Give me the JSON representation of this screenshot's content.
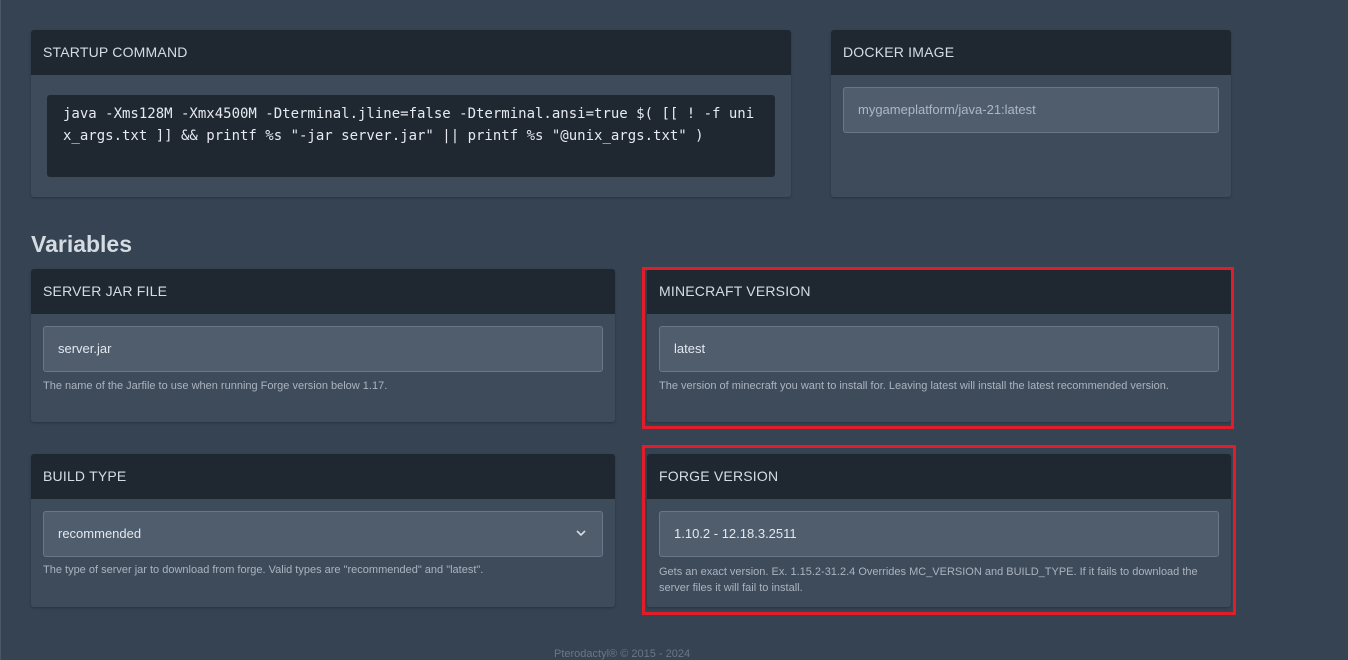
{
  "startup": {
    "title": "STARTUP COMMAND",
    "command": "java -Xms128M -Xmx4500M -Dterminal.jline=false -Dterminal.ansi=true $( [[ ! -f unix_args.txt ]] && printf %s \"-jar server.jar\" || printf %s \"@unix_args.txt\" )"
  },
  "docker": {
    "title": "DOCKER IMAGE",
    "value": "mygameplatform/java-21:latest"
  },
  "variables": {
    "heading": "Variables",
    "server_jar": {
      "title": "SERVER JAR FILE",
      "value": "server.jar",
      "help": "The name of the Jarfile to use when running Forge version below 1.17."
    },
    "minecraft_version": {
      "title": "MINECRAFT VERSION",
      "value": "latest",
      "help": "The version of minecraft you want to install for.  Leaving latest will install the latest recommended version."
    },
    "build_type": {
      "title": "BUILD TYPE",
      "value": "recommended",
      "help": "The type of server jar to download from forge.  Valid types are \"recommended\" and \"latest\"."
    },
    "forge_version": {
      "title": "FORGE VERSION",
      "value": "1.10.2 - 12.18.3.2511",
      "help": "Gets an exact version.  Ex. 1.15.2-31.2.4  Overrides MC_VERSION and BUILD_TYPE. If it fails to download the server files it will fail to install."
    }
  },
  "footer": "Pterodactyl® © 2015 - 2024",
  "colors": {
    "highlight": "#e11d2a",
    "background": "#354353",
    "card_header": "#1f2831"
  }
}
